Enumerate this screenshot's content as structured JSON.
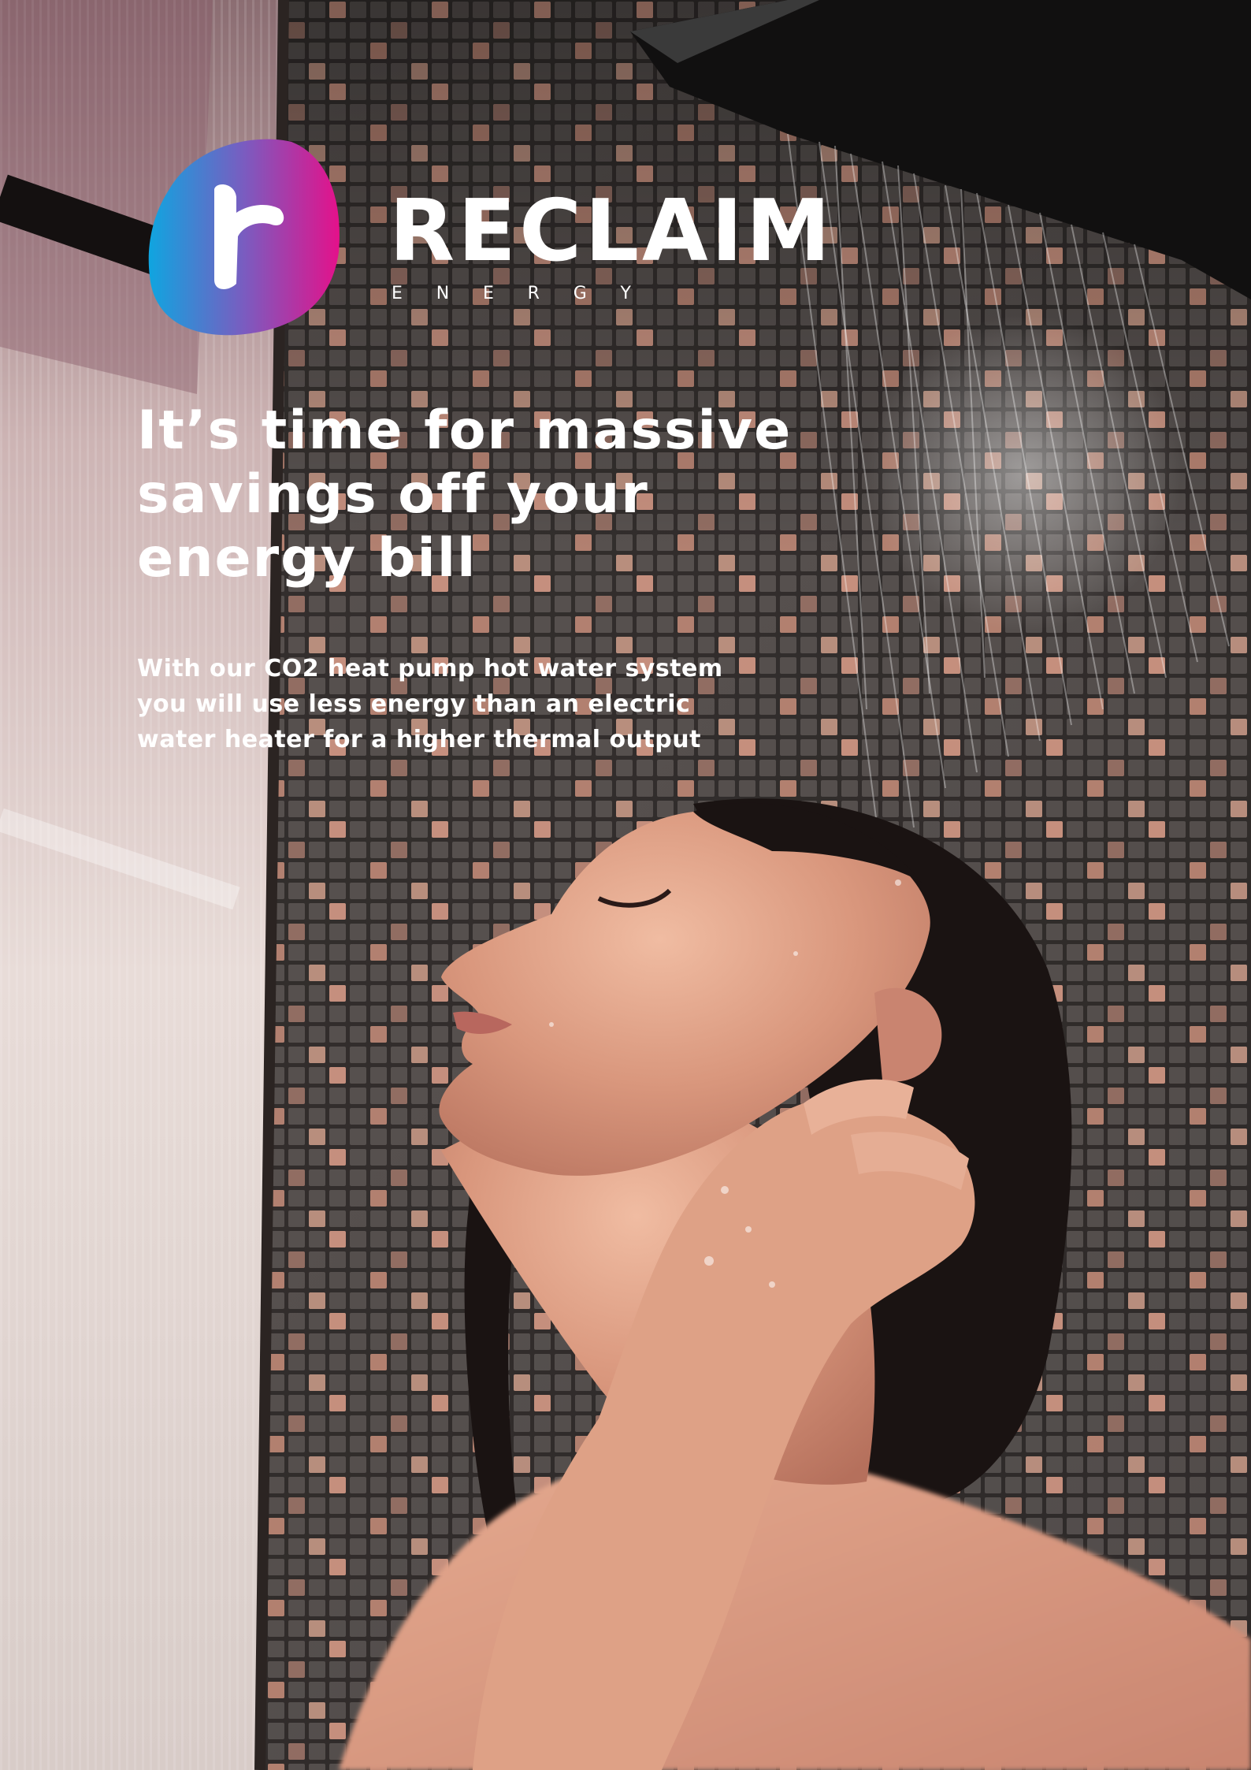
{
  "brand": {
    "name": "RECLAIM",
    "tagline_letters": [
      "E",
      "N",
      "E",
      "R",
      "G",
      "Y"
    ],
    "logo_mark_letter": "r",
    "logo_gradient": [
      "#0fa5e0",
      "#7a5cc0",
      "#e4118a"
    ]
  },
  "headline": {
    "lines": [
      "It’s time for massive",
      "savings off your",
      "energy bill"
    ]
  },
  "body": {
    "lines": [
      "With our CO2 heat pump hot water system",
      "you will use less energy than an electric",
      "water heater for a higher thermal output"
    ]
  },
  "colors": {
    "text": "#ffffff",
    "tile_accent": "#d89a86",
    "skin": "#e0a48a",
    "hair": "#1a1312"
  }
}
